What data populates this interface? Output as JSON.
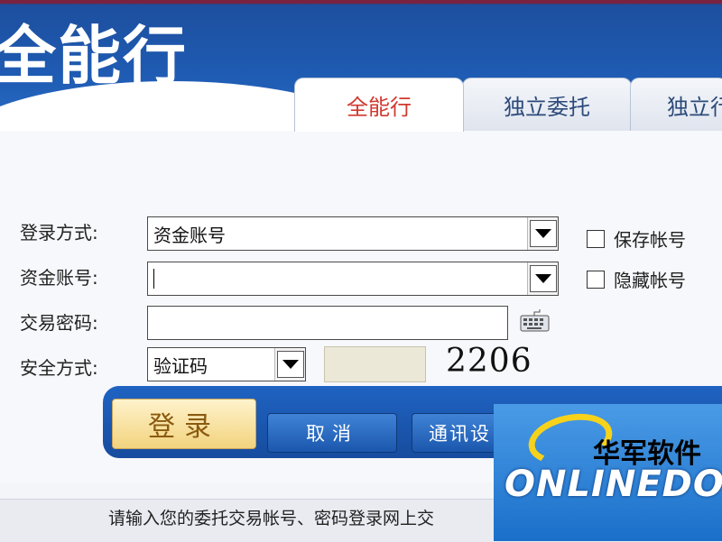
{
  "header": {
    "title": "全能行",
    "tabs": [
      {
        "label": "全能行",
        "active": true
      },
      {
        "label": "独立委托",
        "active": false
      },
      {
        "label": "独立行",
        "active": false
      }
    ]
  },
  "form": {
    "login_method": {
      "label": "登录方式:",
      "value": "资金账号"
    },
    "account": {
      "label": "资金账号:",
      "value": ""
    },
    "password": {
      "label": "交易密码:",
      "value": ""
    },
    "security": {
      "label": "安全方式:",
      "value": "验证码",
      "captcha": "2206"
    },
    "save_account": {
      "label": "保存帐号",
      "checked": false
    },
    "hide_account": {
      "label": "隐藏帐号",
      "checked": false
    }
  },
  "buttons": {
    "login": "登录",
    "cancel": "取消",
    "comm_settings": "通讯设"
  },
  "status": {
    "text": "请输入您的委托交易帐号、密码登录网上交"
  },
  "watermark": {
    "cn": "华军软件",
    "en": "ONLINEDOW"
  },
  "colors": {
    "header_blue": "#1f5cb4",
    "active_tab_text": "#d0392f",
    "login_button": "#f2d37e"
  }
}
